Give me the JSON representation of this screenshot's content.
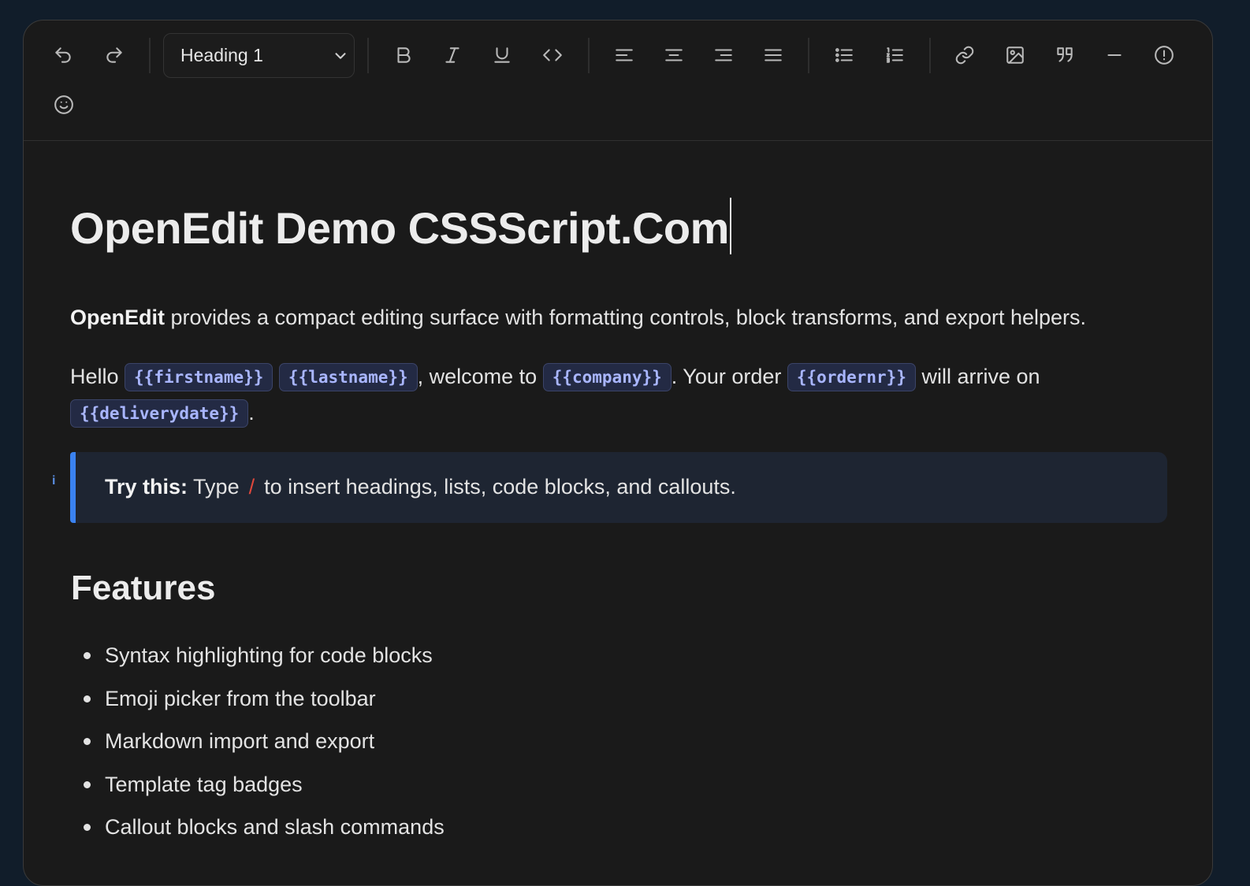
{
  "toolbar": {
    "block_type": "Heading 1",
    "buttons": [
      {
        "name": "undo",
        "icon": "undo-icon"
      },
      {
        "name": "redo",
        "icon": "redo-icon"
      },
      {
        "name": "bold",
        "icon": "bold-icon"
      },
      {
        "name": "italic",
        "icon": "italic-icon"
      },
      {
        "name": "underline",
        "icon": "underline-icon"
      },
      {
        "name": "code",
        "icon": "code-icon"
      },
      {
        "name": "align-left",
        "icon": "align-left-icon"
      },
      {
        "name": "align-center",
        "icon": "align-center-icon"
      },
      {
        "name": "align-right",
        "icon": "align-right-icon"
      },
      {
        "name": "align-justify",
        "icon": "align-justify-icon"
      },
      {
        "name": "bullet-list",
        "icon": "bullet-list-icon"
      },
      {
        "name": "numbered-list",
        "icon": "numbered-list-icon"
      },
      {
        "name": "link",
        "icon": "link-icon"
      },
      {
        "name": "image",
        "icon": "image-icon"
      },
      {
        "name": "quote",
        "icon": "quote-icon"
      },
      {
        "name": "horizontal-rule",
        "icon": "horizontal-rule-icon"
      },
      {
        "name": "callout",
        "icon": "alert-circle-icon"
      },
      {
        "name": "emoji",
        "icon": "emoji-icon"
      }
    ]
  },
  "document": {
    "title": "OpenEdit Demo CSSScript.Com",
    "intro": {
      "bold": "OpenEdit",
      "rest": " provides a compact editing surface with formatting controls, block transforms, and export helpers."
    },
    "template_para": {
      "hello": "Hello ",
      "comma": ", welcome to ",
      "order": ". Your order ",
      "arrive": " will arrive on",
      "end": ".",
      "tags": {
        "firstname": "{{firstname}}",
        "lastname": "{{lastname}}",
        "company": "{{company}}",
        "ordernr": "{{ordernr}}",
        "deliverydate": "{{deliverydate}}"
      }
    },
    "callout": {
      "marker": "i",
      "label": "Try this:",
      "before": " Type",
      "slash": "/",
      "after": "to insert headings, lists, code blocks, and callouts."
    },
    "features_heading": "Features",
    "features": [
      "Syntax highlighting for code blocks",
      "Emoji picker from the toolbar",
      "Markdown import and export",
      "Template tag badges",
      "Callout blocks and slash commands"
    ]
  },
  "colors": {
    "page_bg": "#111d2a",
    "editor_bg": "#1a1a1a",
    "accent": "#3a82f0",
    "tag_text": "#a9b6ff",
    "slash": "#e0483c"
  }
}
